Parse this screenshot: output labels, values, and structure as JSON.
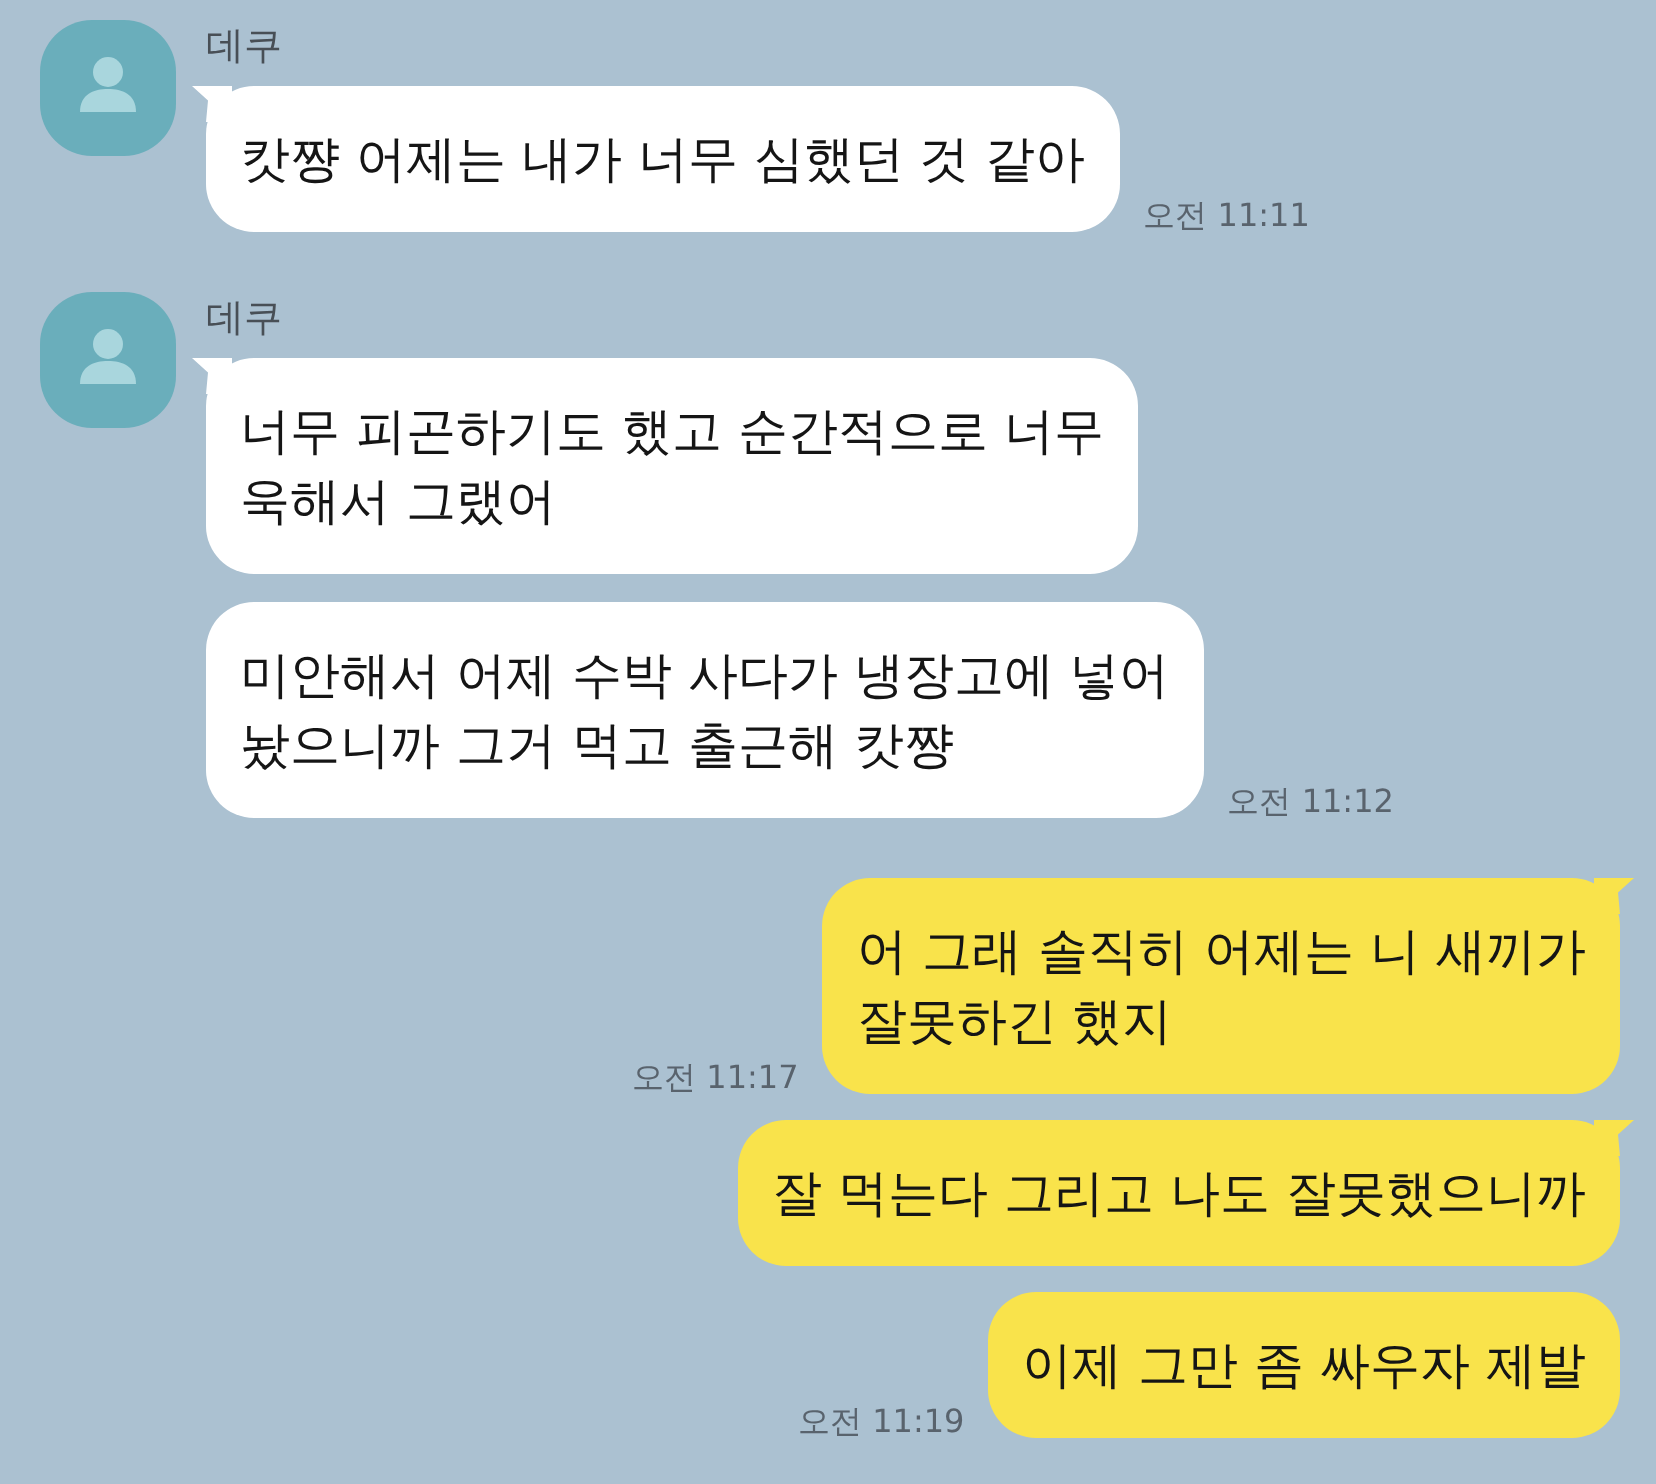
{
  "conversation": [
    {
      "kind": "received",
      "sender": "데쿠",
      "messages": [
        {
          "text": "캇쨩 어제는 내가 너무 심했던 것 같아",
          "tail": true,
          "time": "오전 11:11"
        }
      ]
    },
    {
      "kind": "received",
      "sender": "데쿠",
      "messages": [
        {
          "text": "너무 피곤하기도 했고 순간적으로 너무\n욱해서 그랬어",
          "tail": true
        },
        {
          "text": "미안해서 어제 수박 사다가 냉장고에 넣어\n놨으니까 그거 먹고 출근해 캇쨩",
          "tail": false,
          "time": "오전 11:12"
        }
      ]
    },
    {
      "kind": "sent",
      "messages": [
        {
          "text": "어 그래 솔직히 어제는 니 새끼가\n잘못하긴 했지",
          "tail": true,
          "time": "오전 11:17"
        },
        {
          "text": "잘 먹는다 그리고 나도 잘못했으니까",
          "tail": true
        },
        {
          "text": "이제 그만 좀 싸우자 제발",
          "tail": false,
          "time": "오전 11:19"
        }
      ]
    }
  ]
}
